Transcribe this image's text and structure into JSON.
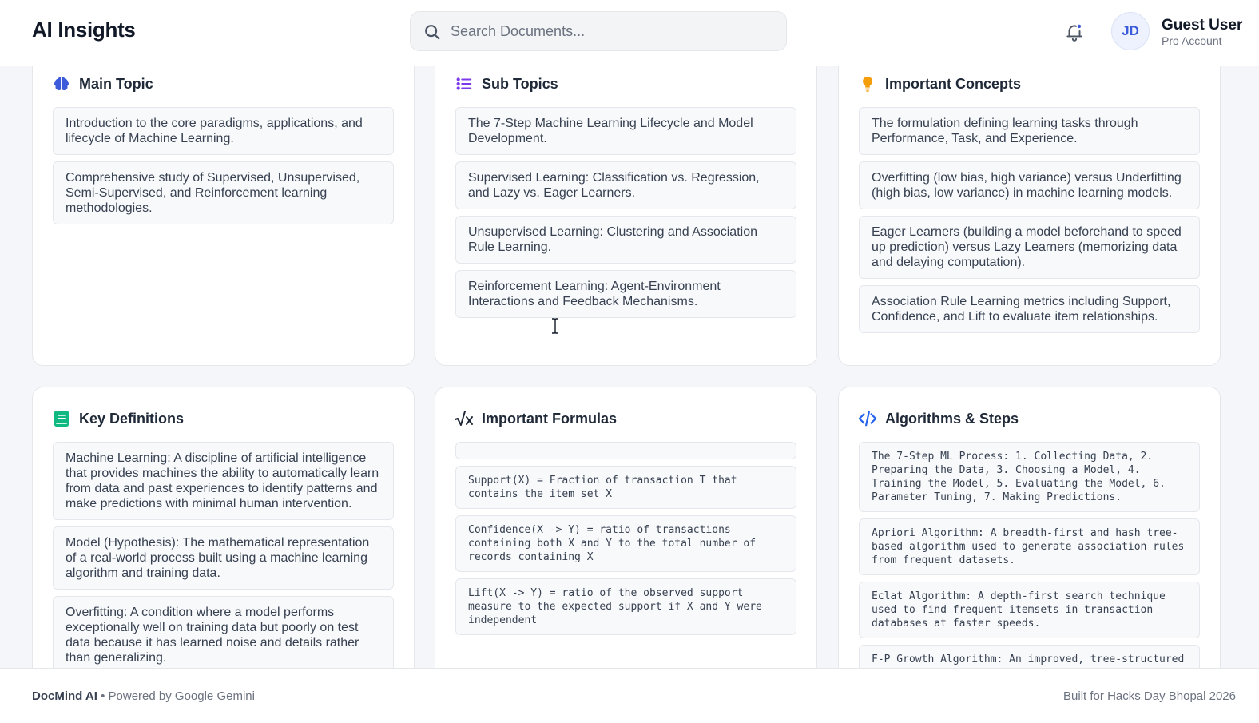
{
  "header": {
    "app_title": "AI Insights",
    "search_placeholder": "Search Documents...",
    "search_value": "",
    "bell_icon": "bell-icon",
    "user": {
      "initials": "JD",
      "name": "Guest User",
      "plan": "Pro Account"
    }
  },
  "colors": {
    "brain": "#3b5bdb",
    "list": "#7c3aed",
    "bulb": "#f59e0b",
    "book": "#10b981",
    "code": "#2563eb"
  },
  "cards": {
    "main_topic": {
      "title": "Main Topic",
      "icon": "brain-icon",
      "items": [
        "Introduction to the core paradigms, applications, and lifecycle of Machine Learning.",
        "Comprehensive study of Supervised, Unsupervised, Semi-Supervised, and Reinforcement learning methodologies."
      ]
    },
    "sub_topics": {
      "title": "Sub Topics",
      "icon": "list-icon",
      "items": [
        "The 7-Step Machine Learning Lifecycle and Model Development.",
        "Supervised Learning: Classification vs. Regression, and Lazy vs. Eager Learners.",
        "Unsupervised Learning: Clustering and Association Rule Learning.",
        "Reinforcement Learning: Agent-Environment Interactions and Feedback Mechanisms."
      ]
    },
    "important_concepts": {
      "title": "Important Concepts",
      "icon": "lightbulb-icon",
      "items": [
        "The formulation defining learning tasks through Performance, Task, and Experience.",
        "Overfitting (low bias, high variance) versus Underfitting (high bias, low variance) in machine learning models.",
        "Eager Learners (building a model beforehand to speed up prediction) versus Lazy Learners (memorizing data and delaying computation).",
        "Association Rule Learning metrics including Support, Confidence, and Lift to evaluate item relationships."
      ]
    },
    "key_definitions": {
      "title": "Key Definitions",
      "icon": "book-icon",
      "items": [
        "Machine Learning: A discipline of artificial intelligence that provides machines the ability to automatically learn from data and past experiences to identify patterns and make predictions with minimal human intervention.",
        "Model (Hypothesis): The mathematical representation of a real-world process built using a machine learning algorithm and training data.",
        "Overfitting: A condition where a model performs exceptionally well on training data but poorly on test data because it has learned noise and details rather than generalizing."
      ]
    },
    "important_formulas": {
      "title": "Important Formulas",
      "icon": "square-root-icon",
      "items": [
        "",
        "Support(X) = Fraction of transaction T that contains the item set X",
        "Confidence(X -> Y) = ratio of transactions containing both X and Y to the total number of records containing X",
        "Lift(X -> Y) = ratio of the observed support measure to the expected support if X and Y were independent"
      ]
    },
    "algorithms_steps": {
      "title": "Algorithms & Steps",
      "icon": "code-icon",
      "items": [
        "The 7-Step ML Process: 1. Collecting Data, 2. Preparing the Data, 3. Choosing a Model, 4. Training the Model, 5. Evaluating the Model, 6. Parameter Tuning, 7. Making Predictions.",
        "Apriori Algorithm: A breadth-first and hash tree-based algorithm used to generate association rules from frequent datasets.",
        "Eclat Algorithm: A depth-first search technique used to find frequent itemsets in transaction databases at faster speeds.",
        "F-P Growth Algorithm: An improved, tree-structured"
      ]
    }
  },
  "footer": {
    "brand": "DocMind AI",
    "powered": " • Powered by Google Gemini",
    "right": "Built for Hacks Day Bhopal 2026"
  }
}
